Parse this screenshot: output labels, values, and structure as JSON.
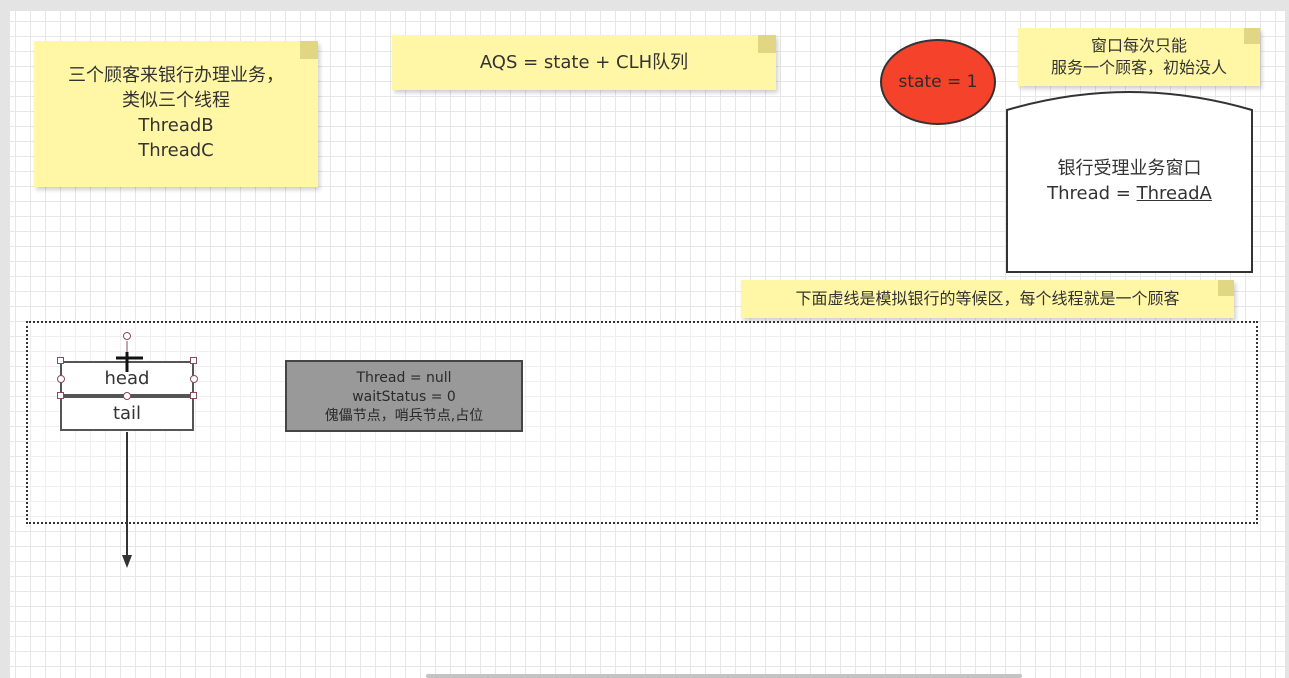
{
  "notes": {
    "customers": {
      "lines": [
        "三个顾客来银行办理业务，",
        "类似三个线程",
        "ThreadB",
        "ThreadC"
      ]
    },
    "aqs": {
      "text": "AQS = state + CLH队列"
    },
    "window_rule": {
      "lines": [
        "窗口每次只能",
        "服务一个顾客，初始没人"
      ]
    },
    "waiting_area": {
      "text": "下面虚线是模拟银行的等候区，每个线程就是一个顾客"
    }
  },
  "state_circle": {
    "label": "state = 1",
    "color": "#f5422a"
  },
  "bank_window": {
    "title": "银行受理业务窗口",
    "thread_prefix": "Thread = ",
    "thread_value": "ThreadA"
  },
  "queue": {
    "head_label": "head",
    "tail_label": "tail",
    "sentinel_node": {
      "lines": [
        "Thread = null",
        "waitStatus = 0",
        "傀儡节点，哨兵节点,占位"
      ],
      "color": "#999999"
    }
  },
  "colors": {
    "note": "#fff7a6",
    "selection_handle": "#8a4a60"
  }
}
